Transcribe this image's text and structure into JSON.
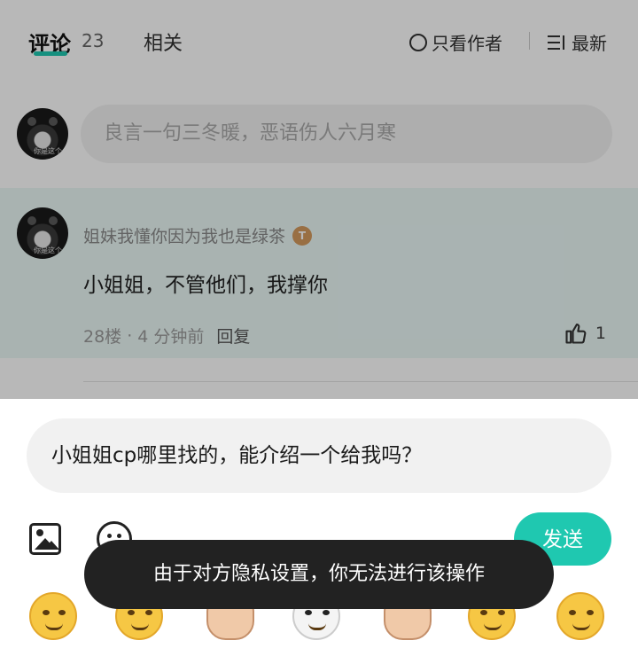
{
  "tabs": {
    "comments_label": "评论",
    "comments_count": "23",
    "related_label": "相关"
  },
  "filters": {
    "author_only_label": "只看作者",
    "sort_label": "最新"
  },
  "comment_box": {
    "placeholder": "良言一句三冬暖，恶语伤人六月寒",
    "avatar_caption": "你是这个"
  },
  "comments": [
    {
      "author": "姐妹我懂你因为我也是绿茶",
      "badge": "T",
      "avatar_caption": "你是这个",
      "text": "小姐姐，不管他们，我撑你",
      "floor": "28楼",
      "separator": "·",
      "time": "4 分钟前",
      "reply_label": "回复",
      "likes": "1"
    }
  ],
  "reply_sheet": {
    "input_value": "小姐姐cp哪里找的，能介绍一个给我吗？",
    "send_label": "发送",
    "image_icon": "image-icon",
    "emoji_icon": "emoji-icon"
  },
  "emoji_row": [
    "smile-emoji",
    "smirk-emoji",
    "thumbs-up-emoji",
    "panda-emoji",
    "fist-emoji",
    "sweat-emoji",
    "flower-emoji"
  ],
  "toast": {
    "message": "由于对方隐私设置，你无法进行该操作"
  },
  "colors": {
    "accent": "#1fc8b0",
    "toast_bg": "#222222",
    "highlight_row": "#eaf8f6"
  }
}
